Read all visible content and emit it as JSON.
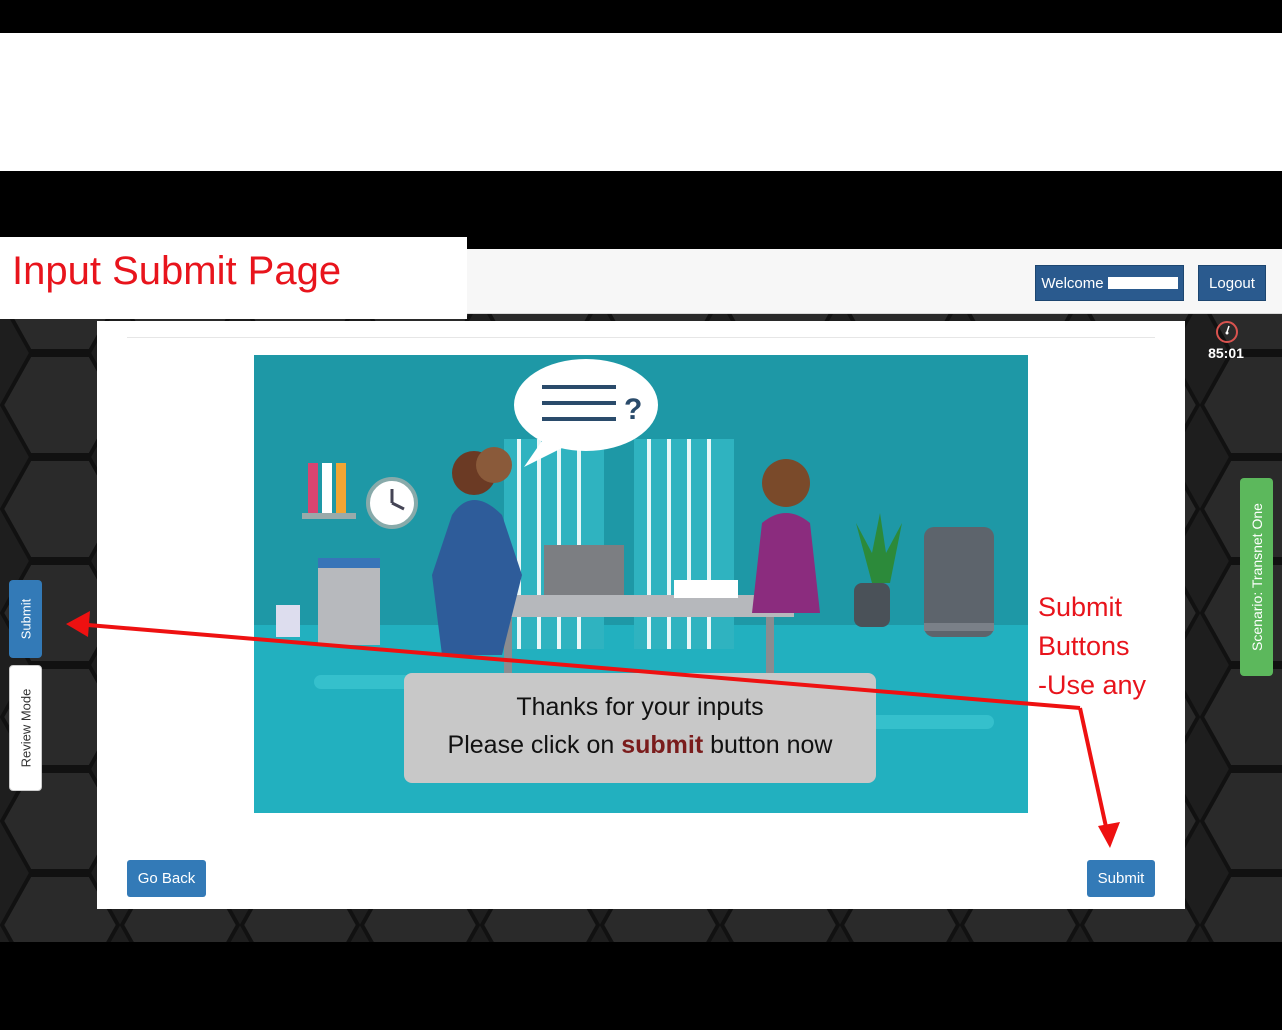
{
  "annotation": {
    "page_label": "Input Submit Page",
    "note_lines": [
      "Submit",
      "Buttons",
      "-Use any"
    ]
  },
  "header": {
    "welcome_label": "Welcome",
    "logout_label": "Logout"
  },
  "timer": {
    "value": "85:01"
  },
  "side_tabs": {
    "submit_label": "Submit",
    "review_label": "Review Mode"
  },
  "scenario": {
    "label": "Scenario: Transnet One"
  },
  "main": {
    "message_line1": "Thanks for your inputs",
    "message_line2_prefix": "Please click on ",
    "message_line2_emphasis": "submit",
    "message_line2_suffix": " button now",
    "go_back_label": "Go Back",
    "submit_label": "Submit"
  },
  "colors": {
    "primary": "#337ab7",
    "nav_button": "#2a5a8e",
    "scenario": "#5cb85c",
    "annotation_red": "#e8141c",
    "illustration_teal": "#1fa3b0"
  }
}
